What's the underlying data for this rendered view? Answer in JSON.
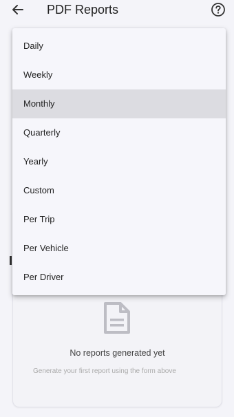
{
  "header": {
    "title": "PDF Reports",
    "back_icon": "arrow-left-icon",
    "help_icon": "help-circle-icon"
  },
  "menu": {
    "items": [
      {
        "label": "Daily"
      },
      {
        "label": "Weekly"
      },
      {
        "label": "Monthly",
        "selected": true
      },
      {
        "label": "Quarterly"
      },
      {
        "label": "Yearly"
      },
      {
        "label": "Custom"
      },
      {
        "label": "Per Trip"
      },
      {
        "label": "Per Vehicle"
      },
      {
        "label": "Per Driver"
      }
    ]
  },
  "empty_state": {
    "icon": "document-icon",
    "title": "No reports generated yet",
    "subtitle": "Generate your first report using the form above"
  },
  "colors": {
    "background": "#f4f4f9",
    "selected_item": "#dcdce1",
    "muted_text": "#aaaaaa"
  }
}
